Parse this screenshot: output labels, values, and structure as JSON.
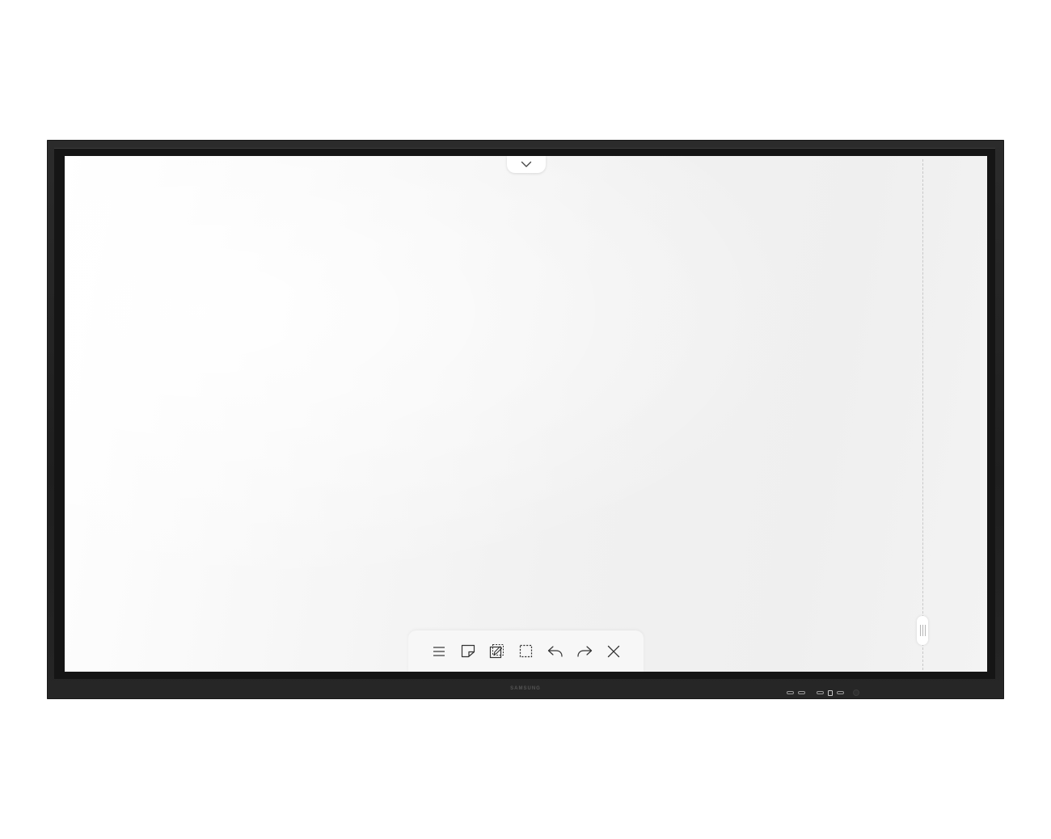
{
  "device": {
    "brand_label": "SAMSUNG"
  },
  "screen": {
    "top_handle_icon": "chevron-down-icon",
    "side_grip_icon": "grip-handle-icon"
  },
  "toolbar": {
    "items": [
      {
        "name": "menu",
        "icon": "menu-icon"
      },
      {
        "name": "sticky-note",
        "icon": "sticky-note-icon"
      },
      {
        "name": "edit-page",
        "icon": "edit-page-icon"
      },
      {
        "name": "select-area",
        "icon": "select-area-icon"
      },
      {
        "name": "undo",
        "icon": "undo-icon"
      },
      {
        "name": "redo",
        "icon": "redo-icon"
      },
      {
        "name": "close",
        "icon": "close-icon"
      }
    ]
  },
  "colors": {
    "bezel": "#222222",
    "screen": "#f2f2f2",
    "toolbar": "#f7f7f7",
    "icon": "#333333"
  }
}
